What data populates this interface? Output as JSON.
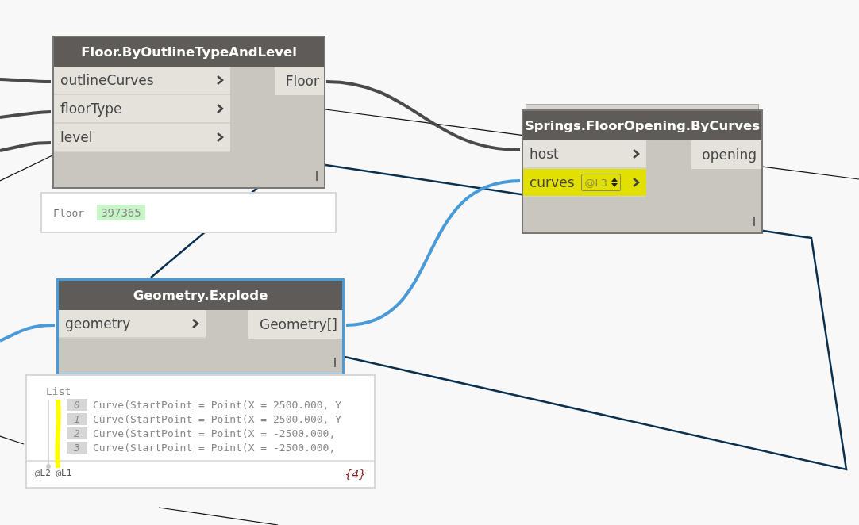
{
  "nodes": [
    {
      "title": "Floor.ByOutlineTypeAndLevel",
      "selected": false,
      "inputs": [
        {
          "name": "outlineCurves",
          "highlighted": false
        },
        {
          "name": "floorType",
          "highlighted": false
        },
        {
          "name": "level",
          "highlighted": false
        }
      ],
      "outputs": [
        "Floor"
      ],
      "preview": {
        "kind": "value",
        "label": "Floor",
        "value": "397365"
      }
    },
    {
      "title": "Springs.FloorOpening.ByCurves",
      "selected": false,
      "inputs": [
        {
          "name": "host",
          "highlighted": false
        },
        {
          "name": "curves",
          "lacing": "@L3",
          "highlighted": true
        }
      ],
      "outputs": [
        "opening"
      ]
    },
    {
      "title": "Geometry.Explode",
      "selected": true,
      "inputs": [
        {
          "name": "geometry",
          "highlighted": false
        }
      ],
      "outputs": [
        "Geometry[]"
      ],
      "preview": {
        "kind": "list",
        "label": "List",
        "highlighted": true,
        "items": [
          {
            "index": "0",
            "text": "Curve(StartPoint = Point(X = 2500.000, Y"
          },
          {
            "index": "1",
            "text": "Curve(StartPoint = Point(X = 2500.000, Y"
          },
          {
            "index": "2",
            "text": "Curve(StartPoint = Point(X = -2500.000,"
          },
          {
            "index": "3",
            "text": "Curve(StartPoint = Point(X = -2500.000,"
          }
        ],
        "levels": "@L2 @L1",
        "count": "{4}"
      }
    }
  ]
}
